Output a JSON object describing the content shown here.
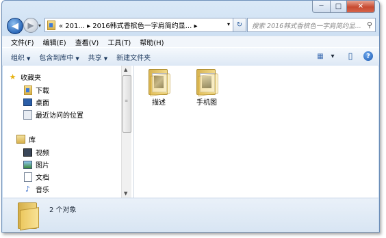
{
  "window": {
    "min": "─",
    "max": "□",
    "close": "✕"
  },
  "nav": {
    "back": "◀",
    "forward": "▶",
    "drop": "▾"
  },
  "address": {
    "path": "« 201... ▸ 2016韩式香槟色一字肩简约显... ▸",
    "arrow": "▾"
  },
  "refresh": "↻",
  "search": {
    "placeholder": "搜索 2016韩式香槟色一字肩简约显...",
    "icon": "⚲"
  },
  "menu": [
    "文件(F)",
    "编辑(E)",
    "查看(V)",
    "工具(T)",
    "帮助(H)"
  ],
  "toolbar": {
    "organize": "组织",
    "include": "包含到库中",
    "share": "共享",
    "new_folder": "新建文件夹",
    "arrow": "▼",
    "view_icon": "▦",
    "view_arrow": "▾",
    "pane_icon": "▯",
    "help": "?"
  },
  "sidebar": {
    "favorites": "收藏夹",
    "downloads": "下载",
    "desktop": "桌面",
    "recent": "最近访问的位置",
    "libraries": "库",
    "videos": "视频",
    "pictures": "图片",
    "documents": "文档",
    "music": "音乐",
    "star": "★",
    "note": "♪"
  },
  "files": [
    {
      "name": "描述"
    },
    {
      "name": "手机图"
    }
  ],
  "status": {
    "count": "2 个对象"
  },
  "scroll": {
    "up": "▲",
    "down": "▼",
    "grip": "≡"
  }
}
